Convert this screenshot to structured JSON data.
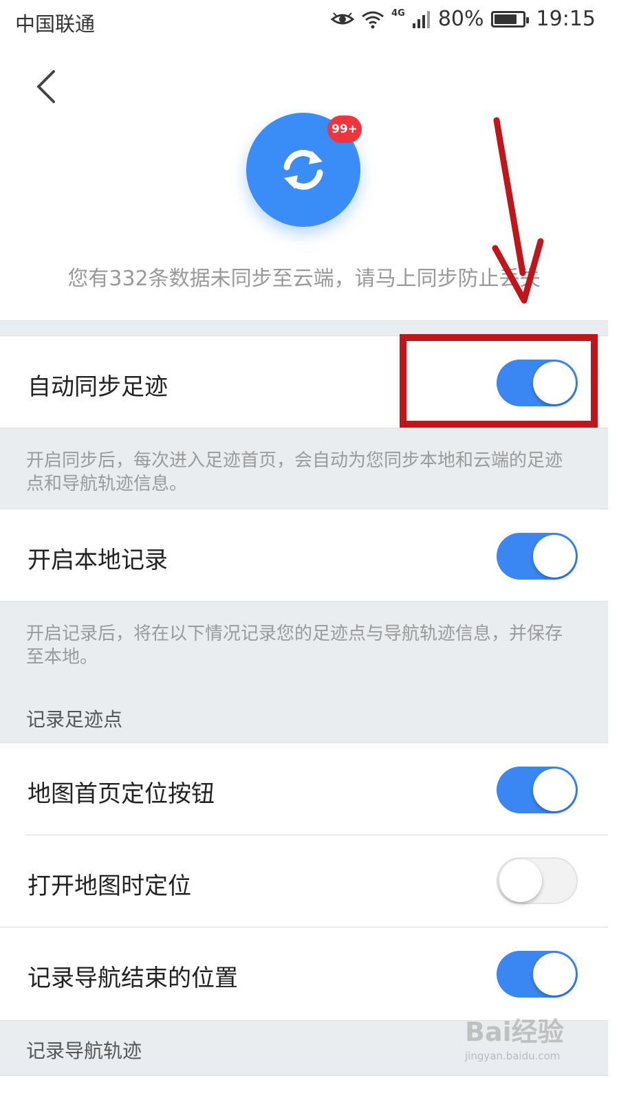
{
  "status_bar": {
    "carrier": "中国联通",
    "network": "4G",
    "battery_text": "80%",
    "battery_level": 0.8,
    "time": "19:15",
    "icons": [
      "eye-icon",
      "wifi-icon",
      "signal-icon",
      "battery-icon"
    ]
  },
  "header": {
    "back_icon": "chevron-left-icon"
  },
  "sync": {
    "icon": "sync-icon",
    "badge": "99+",
    "message": "您有332条数据未同步至云端，请马上同步防止丢失"
  },
  "settings": {
    "auto_sync": {
      "label": "自动同步足迹",
      "on": true,
      "description": "开启同步后，每次进入足迹首页，会自动为您同步本地和云端的足迹点和导航轨迹信息。"
    },
    "local_record": {
      "label": "开启本地记录",
      "on": true,
      "description": "开启记录后，将在以下情况记录您的足迹点与导航轨迹信息，并保存至本地。"
    },
    "section_points": "记录足迹点",
    "locate_button": {
      "label": "地图首页定位按钮",
      "on": true
    },
    "open_map_locate": {
      "label": "打开地图时定位",
      "on": false
    },
    "nav_end_position": {
      "label": "记录导航结束的位置",
      "on": true
    },
    "section_tracks": "记录导航轨迹"
  },
  "annotation": {
    "color": "#c0151a"
  },
  "watermark": {
    "main": "Bai经验",
    "sub": "jingyan.baidu.com"
  },
  "colors": {
    "accent": "#3a86f2",
    "badge": "#f0343c",
    "gray_bg": "#eaedf0"
  }
}
